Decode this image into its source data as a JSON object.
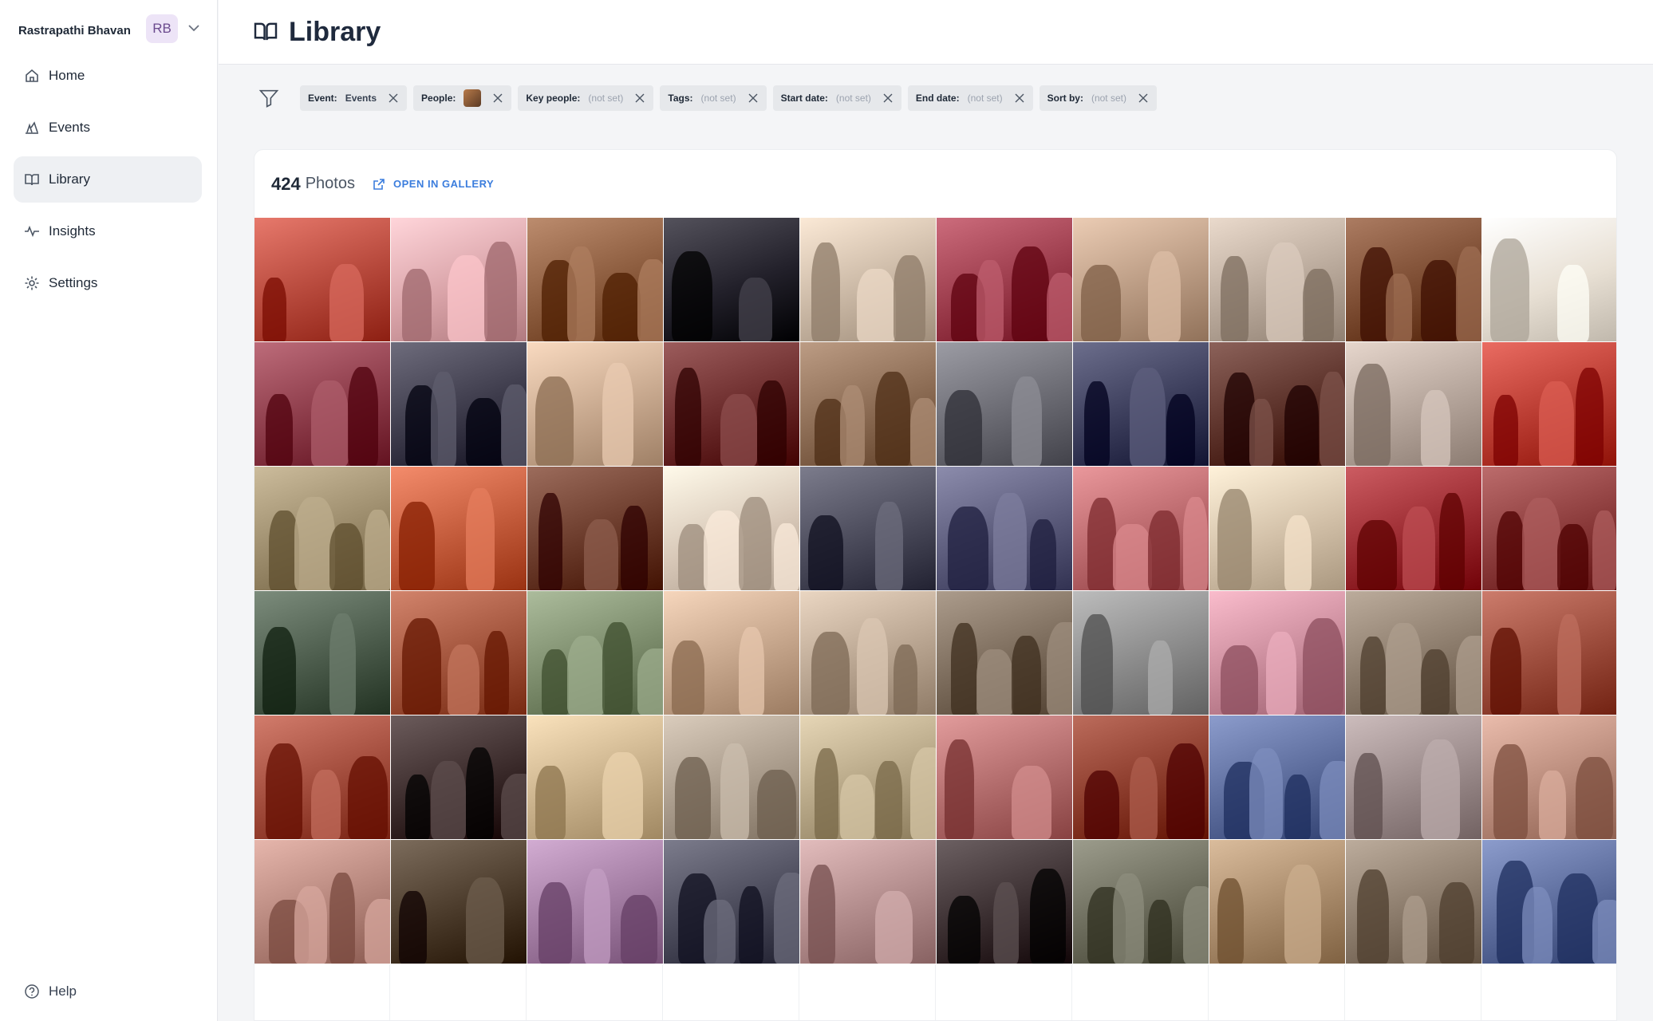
{
  "sidebar": {
    "org_name": "Rastrapathi Bhavan",
    "avatar_initials": "RB",
    "items": [
      {
        "label": "Home",
        "icon": "home-icon"
      },
      {
        "label": "Events",
        "icon": "events-icon"
      },
      {
        "label": "Library",
        "icon": "book-icon"
      },
      {
        "label": "Insights",
        "icon": "pulse-icon"
      },
      {
        "label": "Settings",
        "icon": "gear-icon"
      }
    ],
    "help_label": "Help"
  },
  "header": {
    "title": "Library"
  },
  "filters": [
    {
      "label": "Event:",
      "value": "Events",
      "set": true
    },
    {
      "label": "People:",
      "value": "",
      "set": true,
      "face": true
    },
    {
      "label": "Key people:",
      "value": "(not set)",
      "set": false
    },
    {
      "label": "Tags:",
      "value": "(not set)",
      "set": false
    },
    {
      "label": "Start date:",
      "value": "(not set)",
      "set": false
    },
    {
      "label": "End date:",
      "value": "(not set)",
      "set": false
    },
    {
      "label": "Sort by:",
      "value": "(not set)",
      "set": false
    }
  ],
  "library": {
    "count": "424",
    "count_label": "Photos",
    "gallery_link": "OPEN IN GALLERY"
  },
  "colors": {
    "accent": "#3b7ddd",
    "avatar_bg": "#ede4f7",
    "active_nav": "#eef0f3"
  },
  "photos": [
    "#b5473a",
    "#d9a3a8",
    "#8a5a3c",
    "#22202a",
    "#c9b7a4",
    "#9a3a4a",
    "#b99a82",
    "#b8a89a",
    "#7a4a30",
    "#e8e0d4",
    "#8b3a48",
    "#3c3a4a",
    "#c7a88e",
    "#6a2a2a",
    "#8a6a52",
    "#6a6a72",
    "#3a3c5a",
    "#5a3028",
    "#b4a49a",
    "#b83a30",
    "#9a8a6a",
    "#c25a3a",
    "#6a3a2a",
    "#d8c8b8",
    "#4a4a5a",
    "#5a5a7a",
    "#b8666a",
    "#d2c0a8",
    "#9a2a30",
    "#8a3a3a",
    "#4a5a4a",
    "#a0523a",
    "#7a8a6a",
    "#c4a48a",
    "#b8a490",
    "#7a6a5a",
    "#8a8a8a",
    "#c88a9a",
    "#8a7a6a",
    "#9a4a3a",
    "#a04a3a",
    "#3a2a2a",
    "#c8b08a",
    "#a89a8a",
    "#b4a484",
    "#b06a6a",
    "#8a3a2a",
    "#5a6a9a",
    "#9a8a8a",
    "#b88a7a",
    "#b4847a",
    "#4a3a2a",
    "#a07aa0",
    "#4a4a5a",
    "#b08a8a",
    "#3a2e30",
    "#6a6a5a",
    "#a88a6a",
    "#8a7a6a",
    "#5a6a9a"
  ]
}
